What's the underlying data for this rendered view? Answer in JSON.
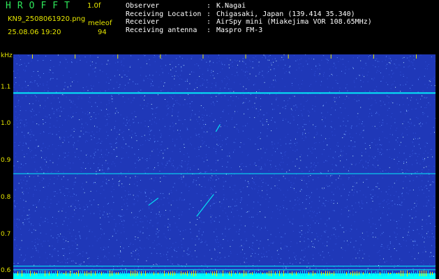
{
  "header": {
    "app_title": "HROFFT",
    "version": "1.0f",
    "filename": "KN9_2508061920.png",
    "mode": "meleof",
    "timestamp": "25.08.06 19:20",
    "count": "94"
  },
  "info": [
    {
      "label": "Observer",
      "value": "K.Nagai"
    },
    {
      "label": "Receiving Location",
      "value": "Chigasaki, Japan (139.414 35.340)"
    },
    {
      "label": "Receiver",
      "value": "AirSpy mini (Miakejima VOR 108.65MHz)"
    },
    {
      "label": "Receiving antenna",
      "value": "Maspro FM-3"
    }
  ],
  "info_separator": ":",
  "chart_data": {
    "type": "heatmap",
    "ylabel": "kHz",
    "y_ticks": [
      "1.1",
      "1.0",
      "0.9",
      "0.8",
      "0.7",
      "0.6"
    ],
    "x_ticks": [
      "1921",
      "1922",
      "1923",
      "1924",
      "1925",
      "1926",
      "1927",
      "1928",
      "1929",
      "1930"
    ],
    "ylim": [
      0.58,
      1.19
    ],
    "xlim": [
      1920.55,
      1930.45
    ],
    "colors": {
      "background": "#1f38b8",
      "noise": "#5a8cff",
      "signal": "#00ffff",
      "text": "#e6e600",
      "bottom_band": "#00ffff"
    }
  }
}
